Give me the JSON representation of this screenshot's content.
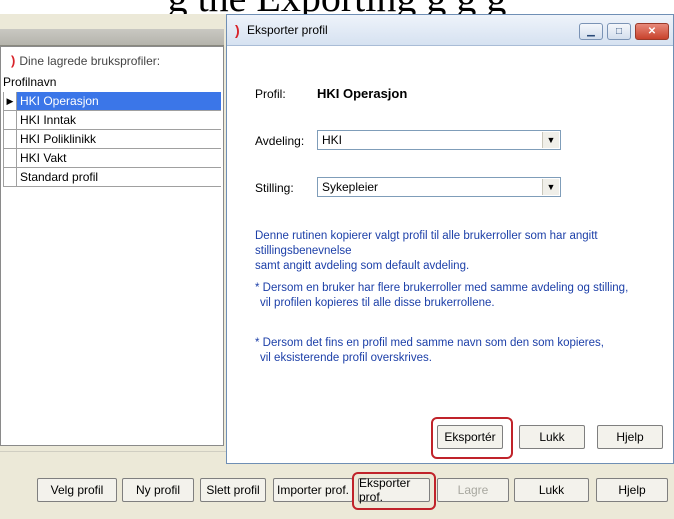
{
  "background_caption": "g the Exporting g g g",
  "left_panel": {
    "title": "Dine lagrede bruksprofiler:",
    "column_header": "Profilnavn",
    "profiles": [
      "HKI Operasjon",
      "HKI Inntak",
      "HKI Poliklinikk",
      "HKI Vakt",
      "Standard profil"
    ],
    "selected_index": 0
  },
  "toolbar": {
    "velg": "Velg profil",
    "ny": "Ny profil",
    "slett": "Slett profil",
    "importer": "Importer prof.",
    "eksporter": "Eksporter prof.",
    "lagre": "Lagre",
    "lukk": "Lukk",
    "hjelp": "Hjelp"
  },
  "dialog": {
    "title": "Eksporter profil",
    "profil_label": "Profil:",
    "profil_value": "HKI Operasjon",
    "avdeling_label": "Avdeling:",
    "avdeling_value": "HKI",
    "stilling_label": "Stilling:",
    "stilling_value": "Sykepleier",
    "info1_line1": "Denne rutinen kopierer valgt profil til alle brukerroller som har angitt stillingsbenevnelse",
    "info1_line2": "samt angitt avdeling som default avdeling.",
    "info2_line1": "* Dersom en bruker har flere brukerroller med samme avdeling og stilling,",
    "info2_line2": "vil profilen kopieres til alle disse brukerrollene.",
    "info3_line1": "* Dersom det fins en profil med samme navn som den som kopieres,",
    "info3_line2": "vil eksisterende profil overskrives.",
    "btn_eksporter": "Eksportér",
    "btn_lukk": "Lukk",
    "btn_hjelp": "Hjelp"
  },
  "colors": {
    "highlight": "#c0232a",
    "selection": "#3b76e8",
    "info_text": "#1c3fa8"
  }
}
